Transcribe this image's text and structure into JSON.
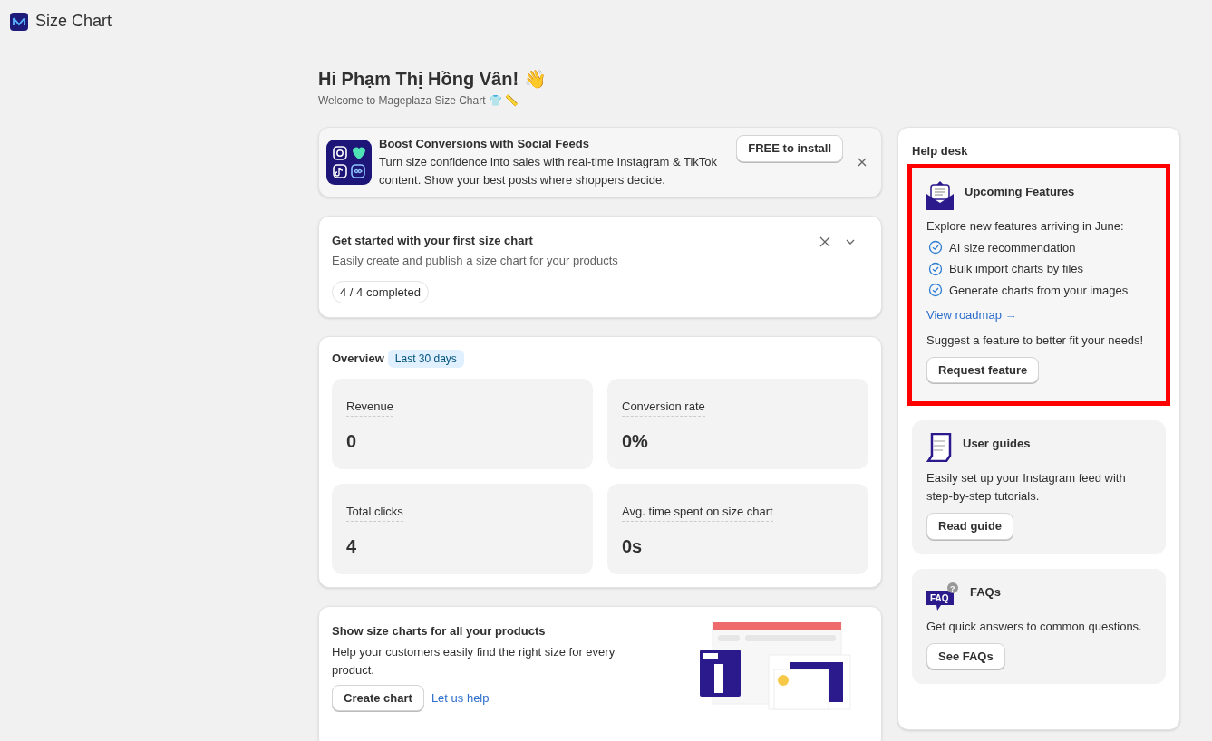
{
  "app": {
    "title": "Size Chart"
  },
  "greeting": {
    "title": "Hi Phạm Thị Hồng Vân! 👋",
    "subtitle": "Welcome to Mageplaza Size Chart 👕 📏"
  },
  "promo": {
    "title": "Boost Conversions with Social Feeds",
    "text": "Turn size confidence into sales with real-time Instagram & TikTok content. Show your best posts where shoppers decide.",
    "button": "FREE to install"
  },
  "setup": {
    "title": "Get started with your first size chart",
    "text": "Easily create and publish a size chart for your products",
    "progress": "4 / 4 completed"
  },
  "overview": {
    "title": "Overview",
    "badge": "Last 30 days",
    "metrics": [
      {
        "label": "Revenue",
        "value": "0"
      },
      {
        "label": "Conversion rate",
        "value": "0%"
      },
      {
        "label": "Total clicks",
        "value": "4"
      },
      {
        "label": "Avg. time spent on size chart",
        "value": "0s"
      }
    ]
  },
  "show_charts": {
    "title": "Show size charts for all your products",
    "text": "Help your customers easily find the right size for every product.",
    "button": "Create chart",
    "link": "Let us help"
  },
  "help_desk": {
    "title": "Help desk",
    "cards": [
      {
        "kind": "features",
        "highlighted": true,
        "title": "Upcoming Features",
        "text": "Explore new features arriving in June:",
        "items": [
          "AI size recommendation",
          "Bulk import charts by files",
          "Generate charts from your images"
        ],
        "link": "View roadmap →",
        "note": "Suggest a feature to better fit your needs!",
        "button": "Request feature"
      },
      {
        "kind": "guides",
        "highlighted": false,
        "title": "User guides",
        "text": "Easily set up your Instagram feed with step-by-step tutorials.",
        "button": "Read guide"
      },
      {
        "kind": "faq",
        "highlighted": false,
        "icon_label": "FAQ",
        "icon_mark": "?",
        "title": "FAQs",
        "text": "Get quick answers to common questions.",
        "button": "See FAQs"
      }
    ]
  }
}
